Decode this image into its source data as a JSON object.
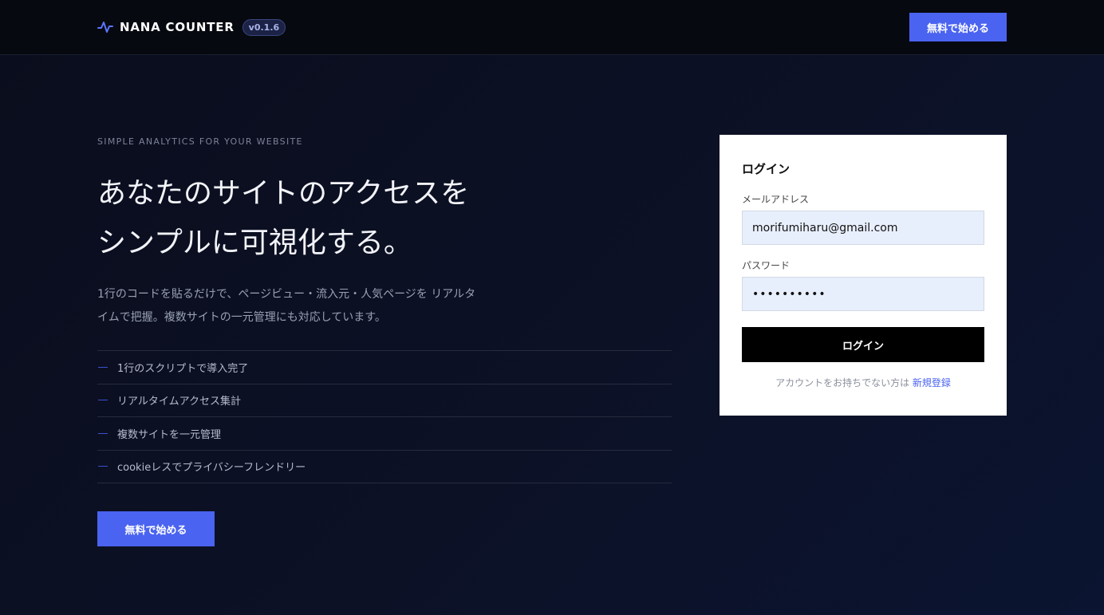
{
  "header": {
    "brand_name": "NANA COUNTER",
    "version": "v0.1.6",
    "cta_label": "無料で始める"
  },
  "hero": {
    "eyebrow": "SIMPLE ANALYTICS FOR YOUR WEBSITE",
    "headline_line1": "あなたのサイトのアクセスを",
    "headline_line2": "シンプルに可視化する。",
    "description": "1行のコードを貼るだけで、ページビュー・流入元・人気ページを リアルタイムで把握。複数サイトの一元管理にも対応しています。",
    "features": [
      "1行のスクリプトで導入完了",
      "リアルタイムアクセス集計",
      "複数サイトを一元管理",
      "cookieレスでプライバシーフレンドリー"
    ],
    "cta_label": "無料で始める"
  },
  "login": {
    "title": "ログイン",
    "email_label": "メールアドレス",
    "email_value": "morifumiharu@gmail.com",
    "password_label": "パスワード",
    "password_value": "••••••••••",
    "submit_label": "ログイン",
    "signup_prompt": "アカウントをお持ちでない方は",
    "signup_link": "新規登録"
  },
  "colors": {
    "accent": "#4a63f0",
    "background": "#0c1126",
    "header_bg": "#070910",
    "card_bg": "#ffffff",
    "login_button": "#000000",
    "input_bg": "#e8effc"
  },
  "icons": {
    "brand": "pulse-line-icon",
    "feature_bullet": "dash-icon"
  }
}
